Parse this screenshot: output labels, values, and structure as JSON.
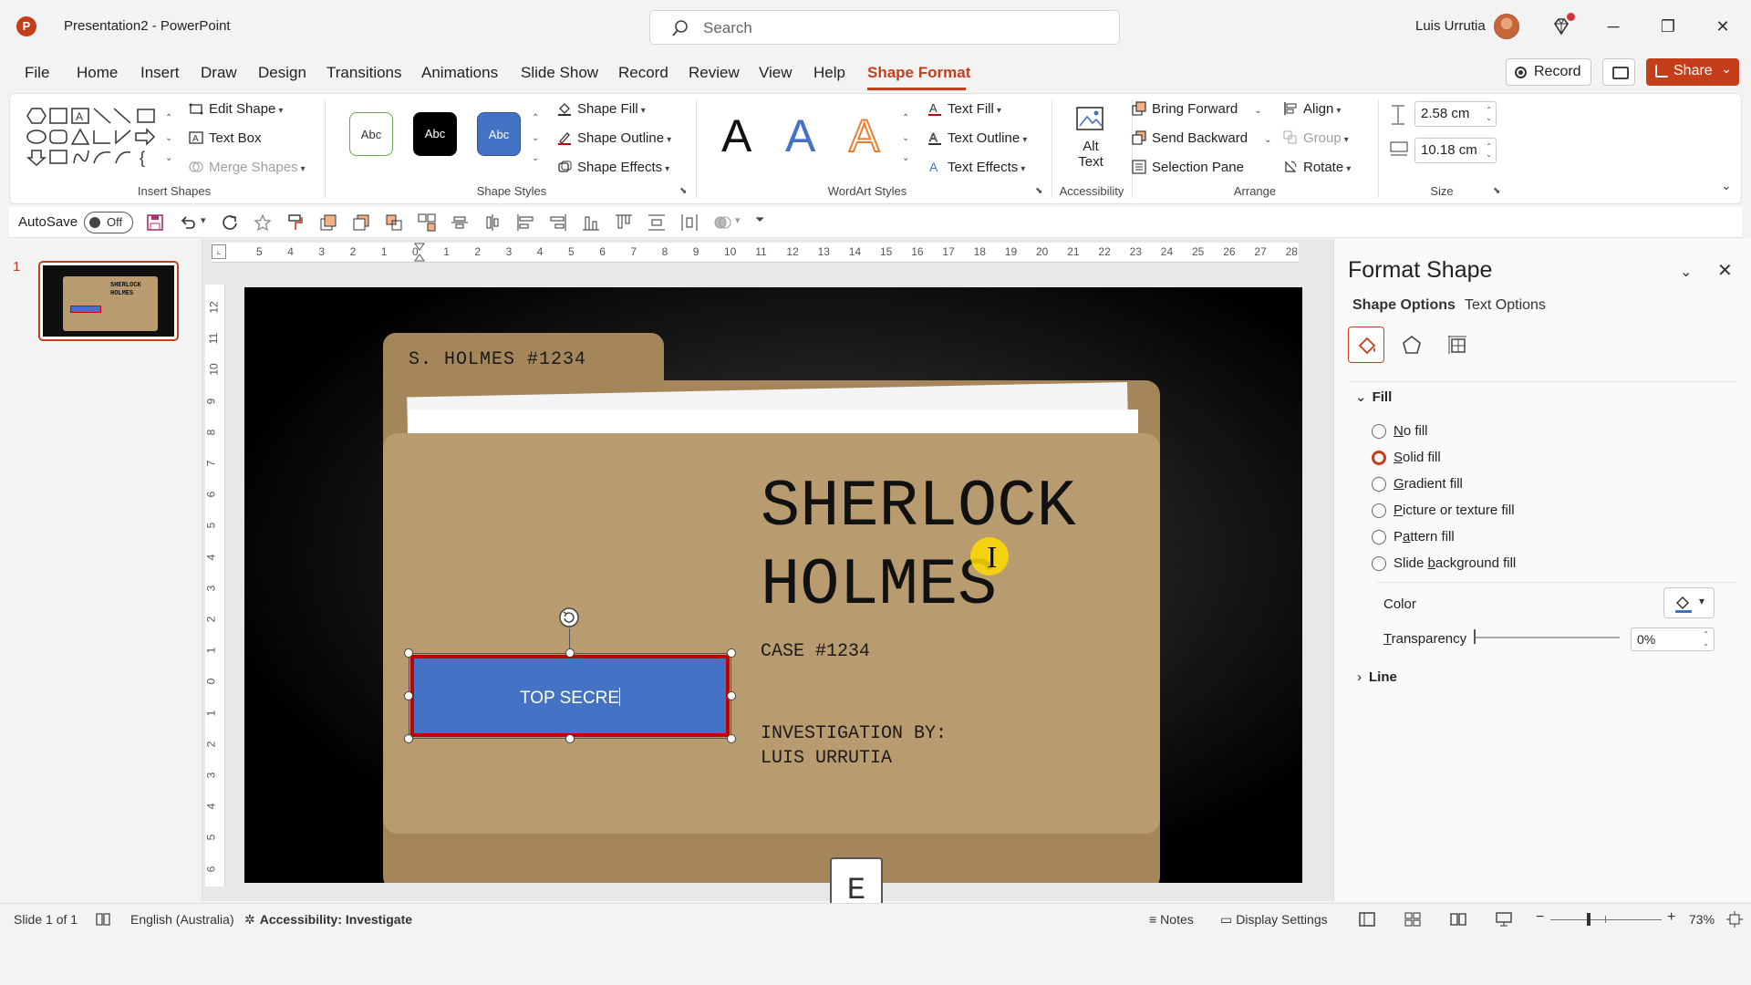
{
  "app": {
    "logo_letter": "P",
    "title": "Presentation2  -  PowerPoint",
    "search_placeholder": "Search",
    "user_name": "Luis Urrutia",
    "minimize": "─",
    "restore": "❐",
    "close": "✕"
  },
  "tabs": [
    "File",
    "Home",
    "Insert",
    "Draw",
    "Design",
    "Transitions",
    "Animations",
    "Slide Show",
    "Record",
    "Review",
    "View",
    "Help",
    "Shape Format"
  ],
  "active_tab": "Shape Format",
  "top_buttons": {
    "record": "Record",
    "share": "Share"
  },
  "ribbon": {
    "insert_shapes": {
      "label": "Insert Shapes",
      "edit_shape": "Edit Shape",
      "text_box": "Text Box",
      "merge_shapes": "Merge Shapes"
    },
    "shape_styles": {
      "label": "Shape Styles",
      "presets": [
        "Abc",
        "Abc",
        "Abc"
      ],
      "shape_fill": "Shape Fill",
      "shape_outline": "Shape Outline",
      "shape_effects": "Shape Effects"
    },
    "wordart": {
      "label": "WordArt Styles",
      "letters": [
        "A",
        "A",
        "A"
      ],
      "text_fill": "Text Fill",
      "text_outline": "Text Outline",
      "text_effects": "Text Effects"
    },
    "accessibility": {
      "label": "Accessibility",
      "alt_text_1": "Alt",
      "alt_text_2": "Text"
    },
    "arrange": {
      "label": "Arrange",
      "bring_forward": "Bring Forward",
      "send_backward": "Send Backward",
      "selection_pane": "Selection Pane",
      "align": "Align",
      "group": "Group",
      "rotate": "Rotate"
    },
    "size": {
      "label": "Size",
      "height": "2.58 cm",
      "width": "10.18 cm"
    }
  },
  "qat": {
    "autosave_label": "AutoSave",
    "autosave_state": "Off"
  },
  "rulers": {
    "horizontal": [
      "5",
      "4",
      "3",
      "2",
      "1",
      "0",
      "1",
      "2",
      "3",
      "4",
      "5",
      "6",
      "7",
      "8",
      "9",
      "10",
      "11",
      "12",
      "13",
      "14",
      "15",
      "16",
      "17",
      "18",
      "19",
      "20",
      "21",
      "22",
      "23",
      "24",
      "25",
      "26",
      "27",
      "28"
    ],
    "vertical": [
      "12",
      "11",
      "10",
      "9",
      "8",
      "7",
      "6",
      "5",
      "4",
      "3",
      "2",
      "1",
      "0",
      "1",
      "2",
      "3",
      "4",
      "5",
      "6"
    ]
  },
  "thumbnails": {
    "slide_number": "1",
    "mini_title": "SHERLOCK HOLMES"
  },
  "slide": {
    "folder_tab": "S. HOLMES #1234",
    "title_line1": "SHERLOCK",
    "title_line2": "HOLMES",
    "case": "CASE #1234",
    "investigation_line1": "INVESTIGATION BY:",
    "investigation_line2": "LUIS URRUTIA",
    "badge_text": "TOP SECRE",
    "below_slide_glyph": "E"
  },
  "format_pane": {
    "title": "Format Shape",
    "tab_shape": "Shape Options",
    "tab_text": "Text Options",
    "fill_section": "Fill",
    "fill_options": [
      "No fill",
      "Solid fill",
      "Gradient fill",
      "Picture or texture fill",
      "Pattern fill",
      "Slide background fill"
    ],
    "selected_fill": "Solid fill",
    "color_label": "Color",
    "transparency_label": "Transparency",
    "transparency_value": "0%",
    "line_section": "Line"
  },
  "status": {
    "slide_info": "Slide 1 of 1",
    "language": "English (Australia)",
    "accessibility": "Accessibility: Investigate",
    "notes": "Notes",
    "display_settings": "Display Settings",
    "zoom": "73%"
  },
  "colors": {
    "accent": "#c43e1c",
    "badge_fill": "#4472c4",
    "badge_outline": "#c00000",
    "folder": "#b89b6e",
    "folder_back": "#a5865b"
  }
}
